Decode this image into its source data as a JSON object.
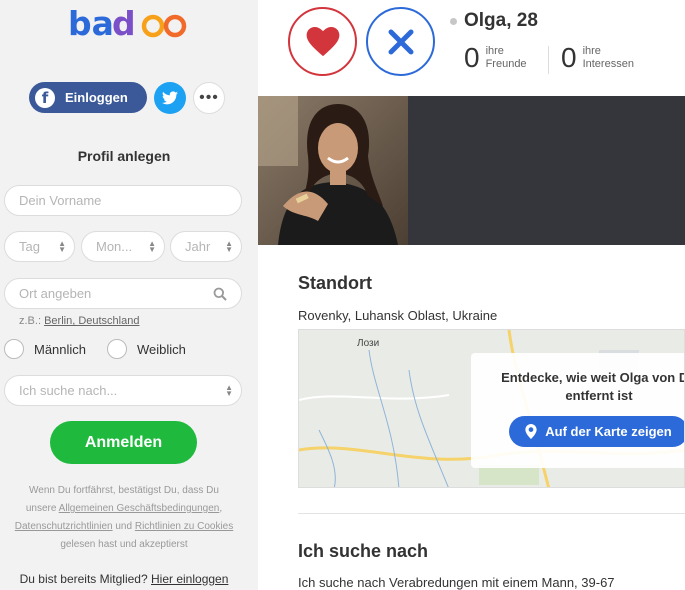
{
  "brand": {
    "logo_text": "badoo",
    "colors": {
      "primary_blue": "#2d6ad9",
      "like_red": "#d3353c",
      "signup_green": "#1fb93d",
      "facebook": "#3b5998",
      "twitter": "#1da1f2"
    }
  },
  "sidebar": {
    "facebook_label": "Einloggen",
    "title": "Profil anlegen",
    "firstname_placeholder": "Dein Vorname",
    "day_placeholder": "Tag",
    "month_placeholder": "Mon...",
    "year_placeholder": "Jahr",
    "location_placeholder": "Ort angeben",
    "hint_prefix": "z.B.:",
    "hint_example": "Berlin, Deutschland",
    "gender_male": "Männlich",
    "gender_female": "Weiblich",
    "looking_for_placeholder": "Ich suche nach...",
    "signup_label": "Anmelden",
    "legal_1": "Wenn Du fortfährst, bestätigst Du, dass Du",
    "legal_2_prefix": "unsere",
    "legal_2_link": "Allgemeinen Geschäftsbedingungen",
    "legal_3_link1": "Datenschutzrichtlinien",
    "legal_3_mid": "und",
    "legal_3_link2": "Richtlinien zu Cookies",
    "legal_4": "gelesen hast und akzeptierst",
    "member_text": "Du bist bereits Mitglied?",
    "member_link": "Hier einloggen"
  },
  "profile": {
    "name_age": "Olga, 28",
    "friends_count": "0",
    "friends_label_1": "ihre",
    "friends_label_2": "Freunde",
    "interests_count": "0",
    "interests_label_1": "ihre",
    "interests_label_2": "Interessen"
  },
  "location": {
    "title": "Standort",
    "place": "Rovenky, Luhansk Oblast, Ukraine",
    "map_label": "Лози",
    "card_text": "Entdecke, wie weit Olga von Dir entfernt ist",
    "map_button": "Auf der Karte zeigen"
  },
  "looking_for": {
    "title": "Ich suche nach",
    "text": "Ich suche nach Verabredungen mit einem Mann, 39-67"
  }
}
